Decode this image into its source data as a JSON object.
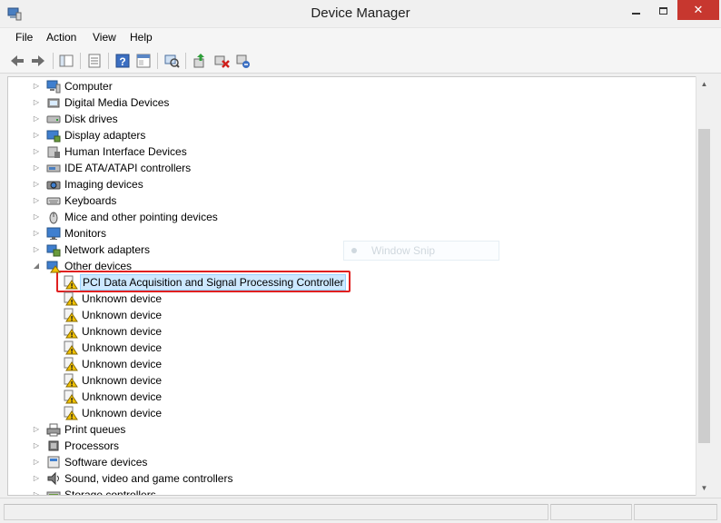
{
  "window": {
    "title": "Device Manager",
    "controls": {
      "close": "✕"
    }
  },
  "menu": [
    "File",
    "Action",
    "View",
    "Help"
  ],
  "toolbar": {
    "buttons": [
      "back-icon",
      "forward-icon",
      "console-tree-icon",
      "properties-icon",
      "help-icon",
      "show-hide-icon",
      "scan-hardware-icon",
      "update-driver-icon",
      "disable-device-icon",
      "uninstall-device-icon"
    ]
  },
  "tree": {
    "categories": [
      {
        "label": "Computer",
        "icon": "computer-icon",
        "expanded": false
      },
      {
        "label": "Digital Media Devices",
        "icon": "media-device-icon",
        "expanded": false
      },
      {
        "label": "Disk drives",
        "icon": "disk-drive-icon",
        "expanded": false
      },
      {
        "label": "Display adapters",
        "icon": "display-adapter-icon",
        "expanded": false
      },
      {
        "label": "Human Interface Devices",
        "icon": "hid-icon",
        "expanded": false
      },
      {
        "label": "IDE ATA/ATAPI controllers",
        "icon": "ide-controller-icon",
        "expanded": false
      },
      {
        "label": "Imaging devices",
        "icon": "imaging-device-icon",
        "expanded": false
      },
      {
        "label": "Keyboards",
        "icon": "keyboard-icon",
        "expanded": false
      },
      {
        "label": "Mice and other pointing devices",
        "icon": "mouse-icon",
        "expanded": false
      },
      {
        "label": "Monitors",
        "icon": "monitor-icon",
        "expanded": false
      },
      {
        "label": "Network adapters",
        "icon": "network-adapter-icon",
        "expanded": false
      },
      {
        "label": "Other devices",
        "icon": "other-devices-icon",
        "expanded": true
      }
    ],
    "other_devices": [
      {
        "label": "PCI Data Acquisition and Signal Processing Controller",
        "selected": true
      },
      {
        "label": "Unknown device"
      },
      {
        "label": "Unknown device"
      },
      {
        "label": "Unknown device"
      },
      {
        "label": "Unknown device"
      },
      {
        "label": "Unknown device"
      },
      {
        "label": "Unknown device"
      },
      {
        "label": "Unknown device"
      },
      {
        "label": "Unknown device"
      }
    ],
    "categories_after": [
      {
        "label": "Print queues",
        "icon": "printer-icon"
      },
      {
        "label": "Processors",
        "icon": "processor-icon"
      },
      {
        "label": "Software devices",
        "icon": "software-device-icon"
      },
      {
        "label": "Sound, video and game controllers",
        "icon": "sound-icon"
      },
      {
        "label": "Storage controllers",
        "icon": "storage-controller-icon"
      }
    ]
  },
  "ghost_tooltip": "Window Snip",
  "colors": {
    "highlight": "#e02020",
    "selection": "#cce8ff",
    "close_button": "#c7372f",
    "warning": "#f2c200"
  }
}
